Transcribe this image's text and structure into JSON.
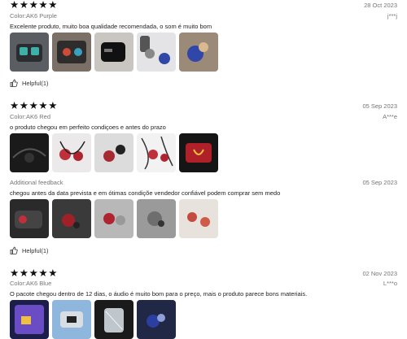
{
  "reviews": [
    {
      "stars": "★★★★★",
      "date": "28 Oct 2023",
      "user": "j***j",
      "color": "Color:AK6 Purple",
      "text": "Excelente produto, muito boa qualidade recomendada, o som é muito bom",
      "photos": [
        "product-photo-1",
        "product-photo-2",
        "product-photo-3",
        "product-photo-4",
        "product-photo-5"
      ],
      "helpful": "Helpful(1)"
    },
    {
      "stars": "★★★★★",
      "date": "05 Sep 2023",
      "user": "A***e",
      "color": "Color:AK6 Red",
      "text": "o produto chegou em perfeito condiçoes e antes do prazo",
      "photos": [
        "product-photo-1",
        "product-photo-2",
        "product-photo-3",
        "product-photo-4",
        "product-photo-5"
      ],
      "additional": {
        "label": "Additional feedback",
        "date": "05 Sep 2023",
        "text": "chegou antes da data prevista e em ótimas condiçõe vendedor confiável podem comprar sem medo",
        "photos": [
          "product-photo-1",
          "product-photo-2",
          "product-photo-3",
          "product-photo-4",
          "product-photo-5"
        ]
      },
      "helpful": "Helpful(1)"
    },
    {
      "stars": "★★★★★",
      "date": "02 Nov 2023",
      "user": "L***o",
      "color": "Color:AK6 Blue",
      "text": "O pacote chegou dentro de 12 dias, o áudio é muito bom para o preço, mais o produto parece bons materiais.",
      "photos": [
        "product-photo-1",
        "product-photo-2",
        "product-photo-3",
        "product-photo-4"
      ]
    }
  ]
}
